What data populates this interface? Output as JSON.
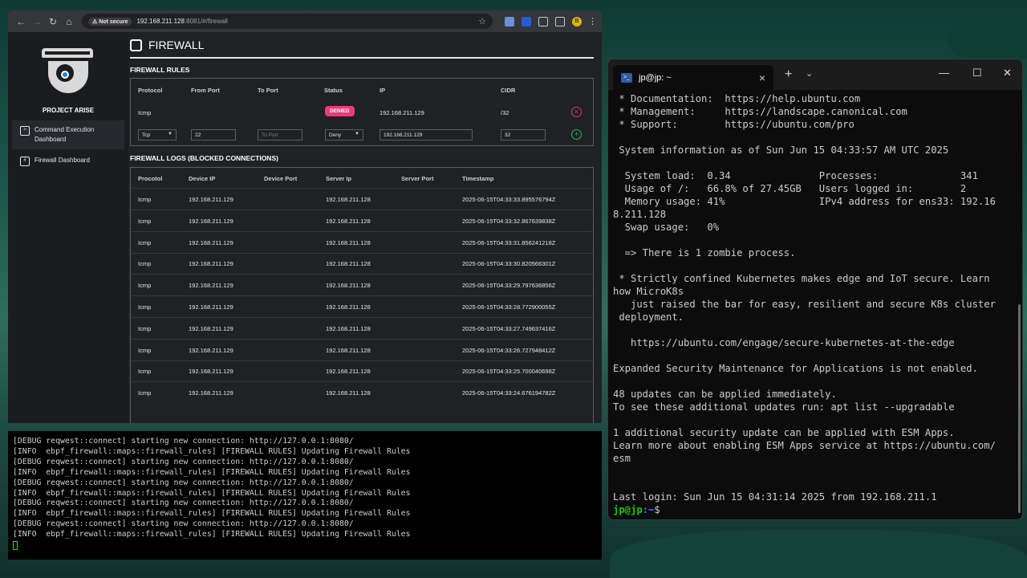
{
  "browser": {
    "url_host": "192.168.211.128",
    "url_rest": ":8081/#/firewall",
    "not_secure_label": "Not secure"
  },
  "sidebar": {
    "project_name": "PROJECT ARISE",
    "items": [
      {
        "label": "Command Execution Dashboard"
      },
      {
        "label": "Firewall Dashboard"
      }
    ]
  },
  "page": {
    "title": "FIREWALL",
    "rules_label": "FIREWALL RULES",
    "logs_label": "FIREWALL LOGS (BLOCKED CONNECTIONS)"
  },
  "rules": {
    "headers": [
      "Protocol",
      "From Port",
      "To Port",
      "Status",
      "IP",
      "CIDR"
    ],
    "row": {
      "protocol": "Icmp",
      "from_port": "",
      "to_port": "",
      "status": "DENIED",
      "ip": "192.168.211.129",
      "cidr": "/32"
    },
    "form": {
      "protocol": "Tcp",
      "from_port": "22",
      "to_port_placeholder": "To Port",
      "action": "Deny",
      "ip": "192.168.211.129",
      "cidr": "32"
    }
  },
  "logs": {
    "headers": [
      "Procotol",
      "Device IP",
      "Device Port",
      "Server Ip",
      "Server Port",
      "Timestamp"
    ],
    "rows": [
      {
        "protocol": "Icmp",
        "device_ip": "192.168.211.129",
        "device_port": "",
        "server_ip": "192.168.211.128",
        "server_port": "",
        "timestamp": "2025-06-15T04:33:33.895576794Z"
      },
      {
        "protocol": "Icmp",
        "device_ip": "192.168.211.129",
        "device_port": "",
        "server_ip": "192.168.211.128",
        "server_port": "",
        "timestamp": "2025-06-15T04:33:32.867639838Z"
      },
      {
        "protocol": "Icmp",
        "device_ip": "192.168.211.129",
        "device_port": "",
        "server_ip": "192.168.211.128",
        "server_port": "",
        "timestamp": "2025-06-15T04:33:31.856241218Z"
      },
      {
        "protocol": "Icmp",
        "device_ip": "192.168.211.129",
        "device_port": "",
        "server_ip": "192.168.211.128",
        "server_port": "",
        "timestamp": "2025-06-15T04:33:30.820566301Z"
      },
      {
        "protocol": "Icmp",
        "device_ip": "192.168.211.129",
        "device_port": "",
        "server_ip": "192.168.211.128",
        "server_port": "",
        "timestamp": "2025-06-15T04:33:29.797636856Z"
      },
      {
        "protocol": "Icmp",
        "device_ip": "192.168.211.129",
        "device_port": "",
        "server_ip": "192.168.211.128",
        "server_port": "",
        "timestamp": "2025-06-15T04:33:28.772900055Z"
      },
      {
        "protocol": "Icmp",
        "device_ip": "192.168.211.129",
        "device_port": "",
        "server_ip": "192.168.211.128",
        "server_port": "",
        "timestamp": "2025-06-15T04:33:27.749637416Z"
      },
      {
        "protocol": "Icmp",
        "device_ip": "192.168.211.129",
        "device_port": "",
        "server_ip": "192.168.211.128",
        "server_port": "",
        "timestamp": "2025-06-15T04:33:26.727948412Z"
      },
      {
        "protocol": "Icmp",
        "device_ip": "192.168.211.129",
        "device_port": "",
        "server_ip": "192.168.211.128",
        "server_port": "",
        "timestamp": "2025-06-15T04:33:25.700040698Z"
      },
      {
        "protocol": "Icmp",
        "device_ip": "192.168.211.129",
        "device_port": "",
        "server_ip": "192.168.211.128",
        "server_port": "",
        "timestamp": "2025-06-15T04:33:24.676194782Z"
      }
    ]
  },
  "debug_terminal": {
    "lines": [
      "[DEBUG reqwest::connect] starting new connection: http://127.0.0.1:8080/",
      "[INFO  ebpf_firewall::maps::firewall_rules] [FIREWALL RULES] Updating Firewall Rules",
      "[DEBUG reqwest::connect] starting new connection: http://127.0.0.1:8080/",
      "[INFO  ebpf_firewall::maps::firewall_rules] [FIREWALL RULES] Updating Firewall Rules",
      "[DEBUG reqwest::connect] starting new connection: http://127.0.0.1:8080/",
      "[INFO  ebpf_firewall::maps::firewall_rules] [FIREWALL RULES] Updating Firewall Rules",
      "[DEBUG reqwest::connect] starting new connection: http://127.0.0.1:8080/",
      "[INFO  ebpf_firewall::maps::firewall_rules] [FIREWALL RULES] Updating Firewall Rules",
      "[DEBUG reqwest::connect] starting new connection: http://127.0.0.1:8080/",
      "[INFO  ebpf_firewall::maps::firewall_rules] [FIREWALL RULES] Updating Firewall Rules"
    ]
  },
  "windows_terminal": {
    "tab_title": "jp@jp: ~",
    "lines": [
      " * Documentation:  https://help.ubuntu.com",
      " * Management:     https://landscape.canonical.com",
      " * Support:        https://ubuntu.com/pro",
      "",
      " System information as of Sun Jun 15 04:33:57 AM UTC 2025",
      "",
      "  System load:  0.34               Processes:              341",
      "  Usage of /:   66.8% of 27.45GB   Users logged in:        2",
      "  Memory usage: 41%                IPv4 address for ens33: 192.16",
      "8.211.128",
      "  Swap usage:   0%",
      "",
      "  => There is 1 zombie process.",
      "",
      " * Strictly confined Kubernetes makes edge and IoT secure. Learn",
      "how MicroK8s",
      "   just raised the bar for easy, resilient and secure K8s cluster",
      " deployment.",
      "",
      "   https://ubuntu.com/engage/secure-kubernetes-at-the-edge",
      "",
      "Expanded Security Maintenance for Applications is not enabled.",
      "",
      "48 updates can be applied immediately.",
      "To see these additional updates run: apt list --upgradable",
      "",
      "1 additional security update can be applied with ESM Apps.",
      "Learn more about enabling ESM Apps service at https://ubuntu.com/",
      "esm",
      "",
      "",
      "Last login: Sun Jun 15 04:31:14 2025 from 192.168.211.1"
    ],
    "prompt_user": "jp@jp",
    "prompt_path": ":~",
    "prompt_symbol": "$"
  }
}
